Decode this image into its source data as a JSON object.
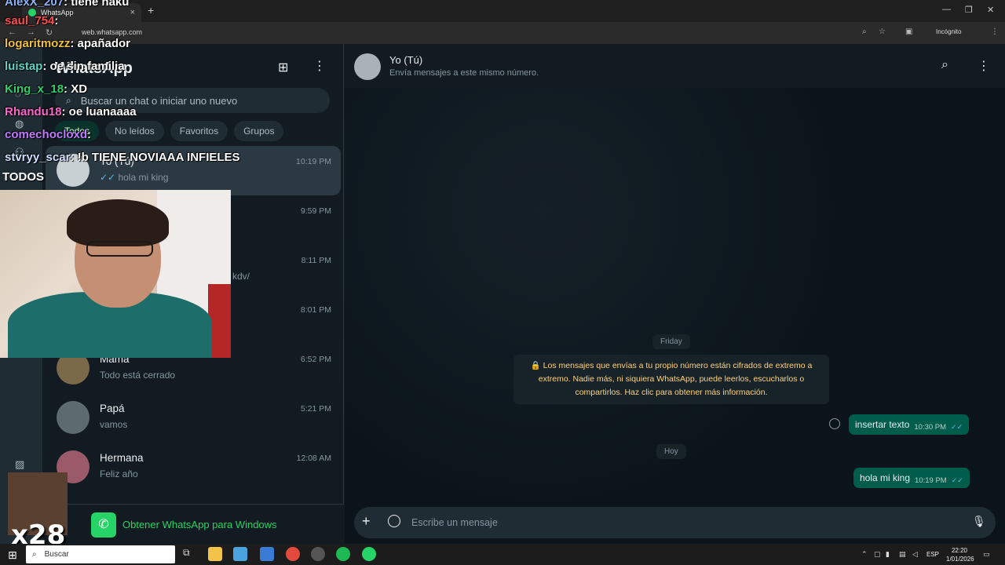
{
  "browser": {
    "tab_title": "WhatsApp",
    "tab_close": "×",
    "new_tab": "+",
    "url": "web.whatsapp.com",
    "incognito": "Incógnito",
    "win_min": "—",
    "win_max": "❐",
    "win_close": "✕"
  },
  "left_panel": {
    "title": "WhatsApp",
    "search_placeholder": "Buscar un chat o iniciar uno nuevo",
    "chips": [
      "Todos",
      "No leídos",
      "Favoritos",
      "Grupos"
    ],
    "chats": [
      {
        "name": "Yo (Tú)",
        "preview": "hola mi king",
        "time": "10:19 PM",
        "selected": true,
        "ticks": "✓✓"
      },
      {
        "name": "",
        "preview": "",
        "time": "9:59 PM"
      },
      {
        "name": "",
        "preview": "kdv/",
        "time": "8:11 PM"
      },
      {
        "name": "",
        "preview": "",
        "time": "8:01 PM"
      },
      {
        "name": "Mamá",
        "preview": "Todo está cerrado",
        "time": "6:52 PM"
      },
      {
        "name": "Papá",
        "preview": "vamos",
        "time": "5:21 PM"
      },
      {
        "name": "Hermana",
        "preview": "Feliz año",
        "time": "12:08 AM"
      }
    ],
    "get_windows": "Obtener WhatsApp para Windows"
  },
  "conversation": {
    "name": "Yo (Tú)",
    "subtitle": "Envía mensajes a este mismo número.",
    "day1": "Friday",
    "encryption_notice": "🔒 Los mensajes que envías a tu propio número están cifrados de extremo a extremo. Nadie más, ni siquiera WhatsApp, puede leerlos, escucharlos o compartirlos. Haz clic para obtener más información.",
    "msg1": {
      "text": "insertar texto",
      "time": "10:30 PM",
      "ticks": "✓✓"
    },
    "day2": "Hoy",
    "msg2": {
      "text": "hola mi king",
      "time": "10:19 PM",
      "ticks": "✓✓"
    },
    "composer_placeholder": "Escribe un mensaje"
  },
  "stream_chat": [
    {
      "user": "AlexX_207",
      "msg": ": tiene haku",
      "color": "#8ab4f8"
    },
    {
      "user": "saul_754",
      "msg": ": ",
      "color": "#ff4d4d"
    },
    {
      "user": "logaritmozz",
      "msg": ": apañador",
      "color": "#f0c040"
    },
    {
      "user": "luistap",
      "msg": ": oe sin familia",
      "color": "#5fd3c6"
    },
    {
      "user": "King_x_18",
      "msg": ": XD",
      "color": "#2fd06b"
    },
    {
      "user": "Rhandu18",
      "msg": ": oe luanaaaa",
      "color": "#ff66cc"
    },
    {
      "user": "comechocloxd",
      "msg": ":",
      "color": "#c07bff"
    },
    {
      "user": "stvryy_scar",
      "msg": ": !b TIENE NOVIAAA INFIELES",
      "color": "#cfe0ff"
    }
  ],
  "stream_todos": "TODOS",
  "meme_counter": "x28",
  "taskbar": {
    "search": "Buscar",
    "lang": "ESP",
    "time": "22:20",
    "date": "1/01/2026"
  }
}
